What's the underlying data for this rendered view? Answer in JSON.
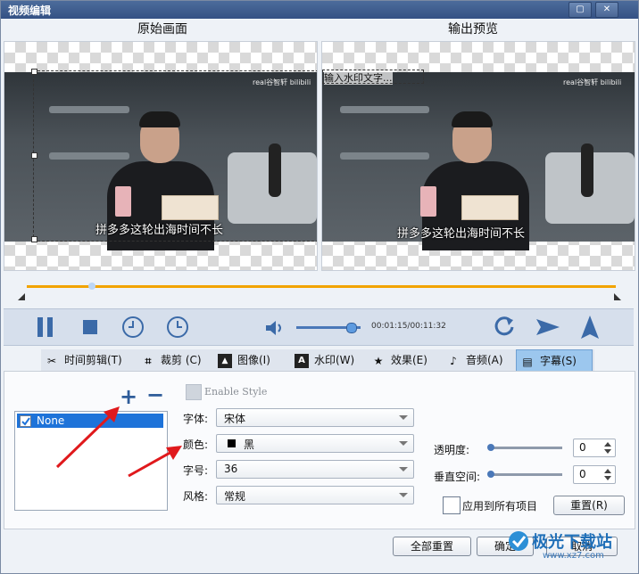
{
  "window": {
    "title": "视频编辑",
    "restore_icon": "restore-icon",
    "close_icon": "close-icon"
  },
  "previews": {
    "original_label": "原始画面",
    "output_label": "输出预览",
    "subtitle_text": "拼多多这轮出海时间不长",
    "watermark_text": "real谷智轩 bilibili",
    "overlay_text": "输入水印文字..."
  },
  "playback": {
    "time": "00:01:15/00:11:32",
    "volume_percent": 85,
    "progress_percent": 11
  },
  "tabs": [
    {
      "label": "时间剪辑(T)",
      "icon": "scissors-icon"
    },
    {
      "label": "裁剪 (C)",
      "icon": "crop-icon"
    },
    {
      "label": "图像(I)",
      "icon": "image-icon"
    },
    {
      "label": "水印(W)",
      "icon": "watermark-icon"
    },
    {
      "label": "效果(E)",
      "icon": "star-icon"
    },
    {
      "label": "音频(A)",
      "icon": "music-note-icon"
    },
    {
      "label": "字幕(S)",
      "icon": "subtitle-icon",
      "active": true
    }
  ],
  "subtitle_panel": {
    "list_items": [
      {
        "label": "None",
        "checked": true
      }
    ],
    "enable_style_label": "Enable Style",
    "font_label": "字体:",
    "font_value": "宋体",
    "color_label": "颜色:",
    "color_value": "黑",
    "size_label": "字号:",
    "size_value": "36",
    "style_label": "风格:",
    "style_value": "常规",
    "opacity_label": "透明度:",
    "opacity_value": "0",
    "vspace_label": "垂直空间:",
    "vspace_value": "0",
    "apply_all_label": "应用到所有项目",
    "reset_label": "重置(R)"
  },
  "footer": {
    "reset_all_label": "全部重置",
    "ok_label": "确定",
    "cancel_label": "取消",
    "logo_text": "极光下载站",
    "logo_url_text": "www.xz7.com"
  },
  "colors": {
    "accent": "#1e73d9",
    "title_bar": "#345184",
    "timeline": "#f2a400",
    "arrow": "#e0191c"
  }
}
